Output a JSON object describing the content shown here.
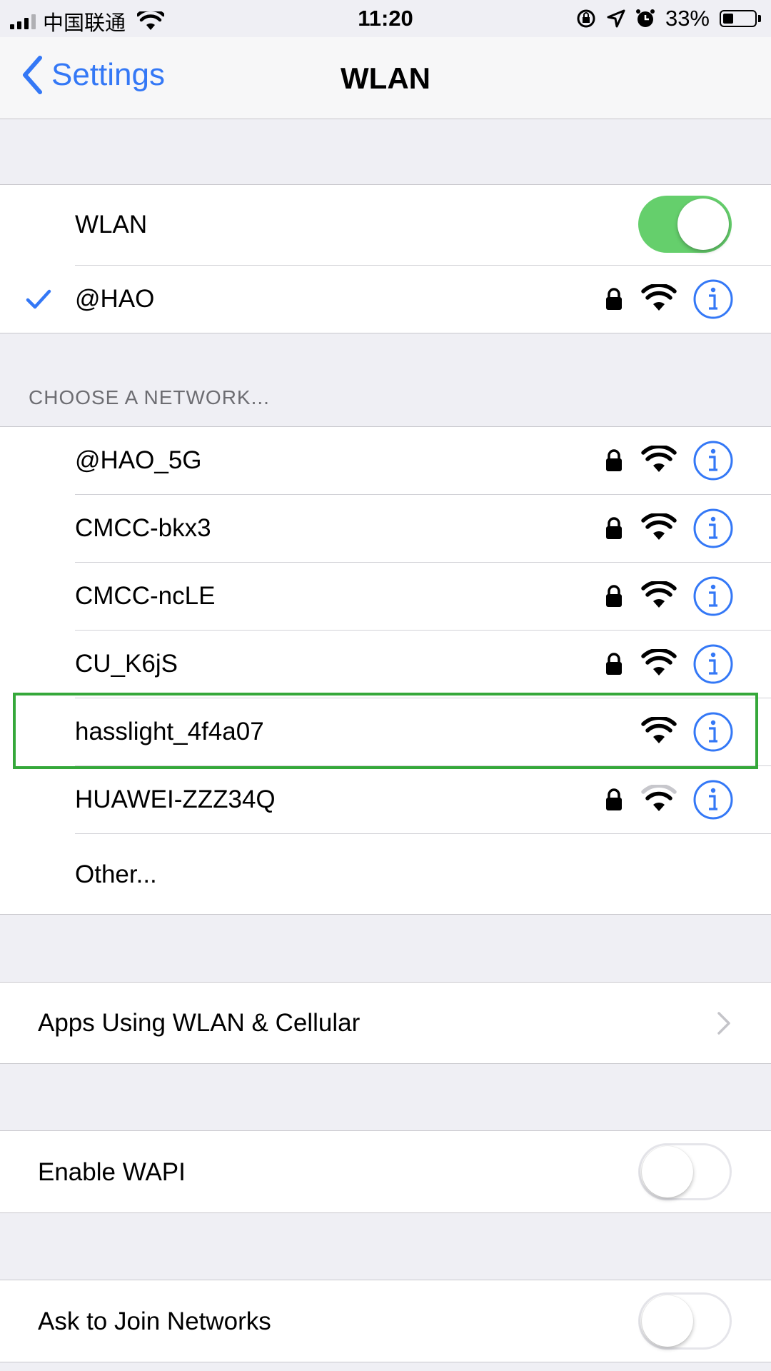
{
  "status_bar": {
    "carrier": "中国联通",
    "time": "11:20",
    "battery_percent": "33%",
    "battery_level": 0.33,
    "signal_bars": 3
  },
  "nav": {
    "back_label": "Settings",
    "title": "WLAN"
  },
  "wlan_toggle": {
    "label": "WLAN",
    "on": true
  },
  "connected_network": {
    "name": "@HAO",
    "secured": true,
    "signal": 3
  },
  "choose_header": "CHOOSE A NETWORK...",
  "networks": [
    {
      "name": "@HAO_5G",
      "secured": true,
      "signal": 3
    },
    {
      "name": "CMCC-bkx3",
      "secured": true,
      "signal": 3
    },
    {
      "name": "CMCC-ncLE",
      "secured": true,
      "signal": 3
    },
    {
      "name": "CU_K6jS",
      "secured": true,
      "signal": 3
    },
    {
      "name": "hasslight_4f4a07",
      "secured": false,
      "signal": 3,
      "highlighted": true
    },
    {
      "name": "HUAWEI-ZZZ34Q",
      "secured": true,
      "signal": 2
    }
  ],
  "other_label": "Other...",
  "apps_using": {
    "label": "Apps Using WLAN & Cellular"
  },
  "enable_wapi": {
    "label": "Enable WAPI",
    "on": false
  },
  "ask_to_join": {
    "label": "Ask to Join Networks",
    "on": false
  },
  "colors": {
    "accent": "#3478f6",
    "toggle_on": "#65cf6c",
    "highlight": "#35a83a",
    "background": "#efeff4"
  },
  "icons": [
    "back-chevron-icon",
    "checkmark-icon",
    "lock-icon",
    "wifi-icon",
    "info-icon",
    "chevron-right-icon",
    "location-icon",
    "alarm-icon",
    "orientation-lock-icon"
  ]
}
